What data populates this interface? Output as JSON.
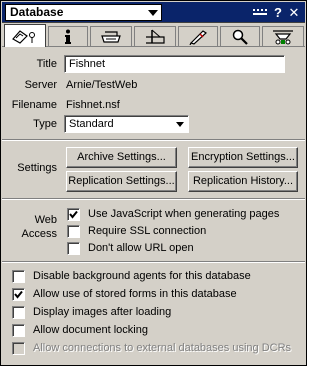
{
  "titlebar": {
    "title": "Database",
    "buttons": [
      "help-icon",
      "close-icon"
    ]
  },
  "tabs": [
    {
      "name": "info",
      "icon": "database-info-icon",
      "active": true
    },
    {
      "name": "info-i",
      "icon": "info-icon"
    },
    {
      "name": "printer",
      "icon": "printer-icon"
    },
    {
      "name": "design",
      "icon": "design-icon"
    },
    {
      "name": "launch",
      "icon": "launch-icon"
    },
    {
      "name": "search",
      "icon": "search-icon"
    },
    {
      "name": "advanced",
      "icon": "advanced-icon"
    }
  ],
  "fields": {
    "title_label": "Title",
    "title_value": "Fishnet",
    "server_label": "Server",
    "server_value": "Arnie/TestWeb",
    "filename_label": "Filename",
    "filename_value": "Fishnet.nsf",
    "type_label": "Type",
    "type_value": "Standard"
  },
  "settings": {
    "label": "Settings",
    "archive": "Archive Settings...",
    "encryption": "Encryption Settings...",
    "replication": "Replication Settings...",
    "replication_history": "Replication History..."
  },
  "web_access": {
    "label_line1": "Web",
    "label_line2": "Access",
    "options": [
      {
        "label": "Use JavaScript when generating pages",
        "checked": true
      },
      {
        "label": "Require SSL connection",
        "checked": false
      },
      {
        "label": "Don't allow URL open",
        "checked": false
      }
    ]
  },
  "options": [
    {
      "label": "Disable background agents for this database",
      "checked": false,
      "disabled": false
    },
    {
      "label": "Allow use of stored forms in this database",
      "checked": true,
      "disabled": false
    },
    {
      "label": "Display images after loading",
      "checked": false,
      "disabled": false
    },
    {
      "label": "Allow document locking",
      "checked": false,
      "disabled": false
    },
    {
      "label": "Allow connections to external databases using DCRs",
      "checked": false,
      "disabled": true
    }
  ],
  "colors": {
    "titlebar": "#0a246a",
    "face": "#d4d0c8"
  }
}
